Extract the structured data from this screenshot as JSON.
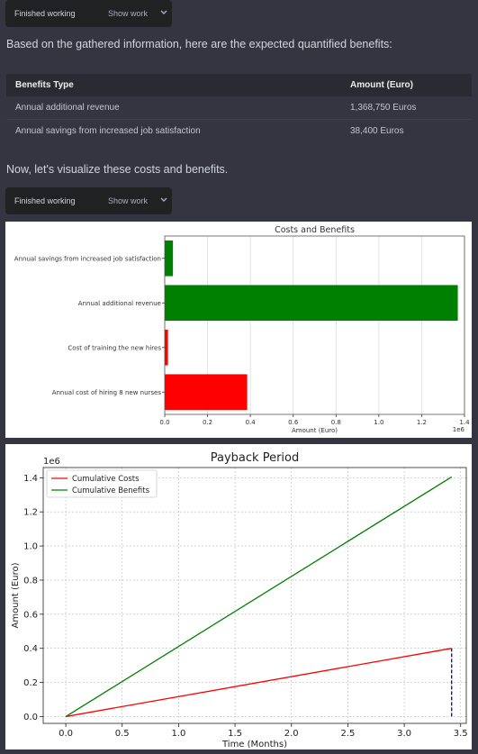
{
  "status_pill_1": {
    "label": "Finished working",
    "action": "Show work"
  },
  "intro_text": "Based on the gathered information, here are the expected quantified benefits:",
  "benefits_table": {
    "headers": [
      "Benefits Type",
      "Amount (Euro)"
    ],
    "rows": [
      [
        "Annual additional revenue",
        "1,368,750 Euros"
      ],
      [
        "Annual savings from increased job satisfaction",
        "38,400 Euros"
      ]
    ]
  },
  "visualize_text": "Now, let's visualize these costs and benefits.",
  "status_pill_2": {
    "label": "Finished working",
    "action": "Show work"
  },
  "chart_data": [
    {
      "type": "bar",
      "orientation": "horizontal",
      "title": "Costs and Benefits",
      "xlabel": "Amount (Euro)",
      "ylabel": "",
      "x_scale_label": "1e6",
      "xlim": [
        0,
        1.4
      ],
      "xticks": [
        "0.0",
        "0.2",
        "0.4",
        "0.6",
        "0.8",
        "1.0",
        "1.2",
        "1.4"
      ],
      "categories": [
        "Annual savings from increased job satisfaction",
        "Annual additional revenue",
        "Cost of training the new hires",
        "Annual cost of hiring 8 new nurses"
      ],
      "values": [
        38400,
        1368750,
        15000,
        385000
      ],
      "colors": [
        "#008000",
        "#008000",
        "#ff0000",
        "#ff0000"
      ],
      "grid": true
    },
    {
      "type": "line",
      "title": "Payback Period",
      "xlabel": "Time (Months)",
      "ylabel": "Amount (Euro)",
      "y_scale_label": "1e6",
      "xlim": [
        -0.2,
        3.55
      ],
      "ylim": [
        -0.04,
        1.46
      ],
      "xticks": [
        "0.0",
        "0.5",
        "1.0",
        "1.5",
        "2.0",
        "2.5",
        "3.0",
        "3.5"
      ],
      "yticks": [
        "0.0",
        "0.2",
        "0.4",
        "0.6",
        "0.8",
        "1.0",
        "1.2",
        "1.4"
      ],
      "legend_position": "top-left",
      "grid": true,
      "series": [
        {
          "name": "Cumulative Costs",
          "color": "#ff0000",
          "x": [
            0,
            3.42
          ],
          "y": [
            0,
            0.4
          ]
        },
        {
          "name": "Cumulative Benefits",
          "color": "#008000",
          "x": [
            0,
            3.42
          ],
          "y": [
            0,
            1.405
          ]
        }
      ],
      "marker_line": {
        "x": 3.42,
        "y": [
          0,
          0.4
        ],
        "color": "#0000cc",
        "style": "dashed"
      }
    }
  ]
}
